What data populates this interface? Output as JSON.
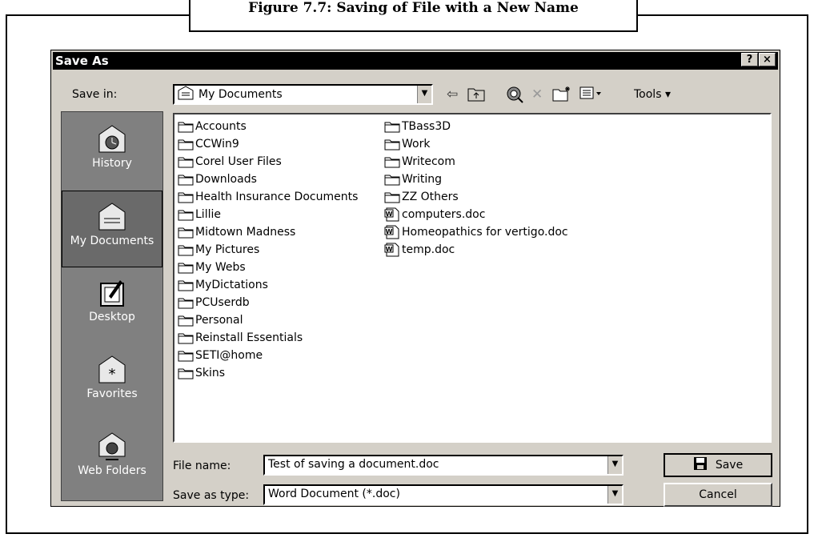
{
  "figure": {
    "caption": "Figure 7.7: Saving of File with a New Name"
  },
  "dialog": {
    "title": "Save As",
    "help_label": "?",
    "close_label": "×",
    "save_in_label": "Save in:",
    "save_in_value": "My Documents",
    "tools_label": "Tools ▾"
  },
  "places": [
    {
      "label": "History",
      "icon": "history-icon"
    },
    {
      "label": "My Documents",
      "icon": "my-documents-icon"
    },
    {
      "label": "Desktop",
      "icon": "desktop-icon"
    },
    {
      "label": "Favorites",
      "icon": "favorites-icon"
    },
    {
      "label": "Web Folders",
      "icon": "web-folders-icon"
    }
  ],
  "files_col1": [
    "Accounts",
    "CCWin9",
    "Corel User Files",
    "Downloads",
    "Health Insurance Documents",
    "Lillie",
    "Midtown Madness",
    "My Pictures",
    "My Webs",
    "MyDictations",
    "PCUserdb",
    "Personal",
    "Reinstall Essentials",
    "SETI@home",
    "Skins"
  ],
  "files_col2": [
    {
      "name": "TBass3D",
      "type": "folder"
    },
    {
      "name": "Work",
      "type": "folder"
    },
    {
      "name": "Writecom",
      "type": "folder"
    },
    {
      "name": "Writing",
      "type": "folder"
    },
    {
      "name": "ZZ Others",
      "type": "folder"
    },
    {
      "name": "computers.doc",
      "type": "doc"
    },
    {
      "name": "Homeopathics for vertigo.doc",
      "type": "doc"
    },
    {
      "name": "temp.doc",
      "type": "doc"
    }
  ],
  "form": {
    "file_name_label": "File name:",
    "file_name_value": "Test of saving a document.doc",
    "save_type_label": "Save as type:",
    "save_type_value": "Word Document (*.doc)",
    "save_button": "Save",
    "cancel_button": "Cancel"
  }
}
